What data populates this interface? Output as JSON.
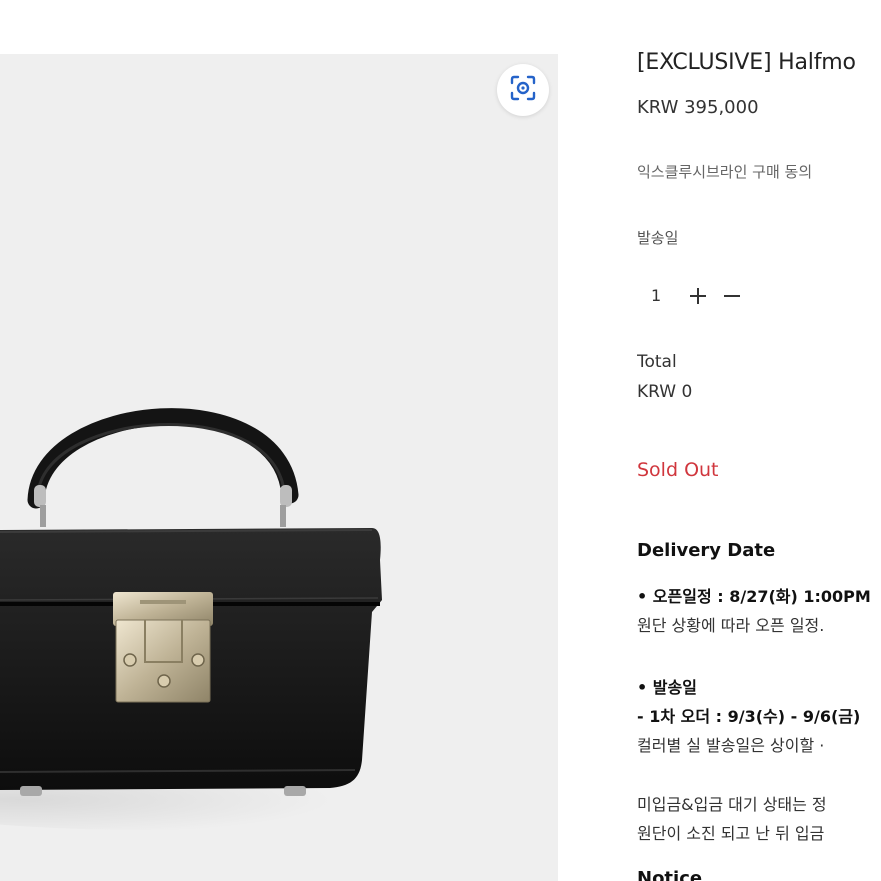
{
  "product": {
    "title": "[EXCLUSIVE] Halfmo",
    "price": "KRW 395,000",
    "agreement_label": "익스클루시브라인 구매 동의",
    "ship_date_label": "발송일",
    "image_alt": "black caviar leather vanity box bag with silver lock"
  },
  "quantity": {
    "value": "1",
    "plus_icon": "plus-icon",
    "minus_icon": "minus-icon"
  },
  "total": {
    "label": "Total",
    "value": "KRW 0"
  },
  "status": {
    "sold_out": "Sold Out",
    "color": "#d0363d"
  },
  "delivery": {
    "title": "Delivery Date",
    "lines": [
      "• 오픈일정 : 8/27(화) 1:00PM",
      "원단 상황에 따라 오픈 일정.",
      "• 발송일",
      "- 1차 오더 : 9/3(수) - 9/6(금)",
      "컬러별 실 발송일은 상이할 ·",
      "미입금&입금 대기 상태는 정",
      "원단이 소진 되고 난 뒤 입금"
    ]
  },
  "notice": {
    "title": "Notice"
  },
  "lens": {
    "icon": "visual-search-icon"
  }
}
